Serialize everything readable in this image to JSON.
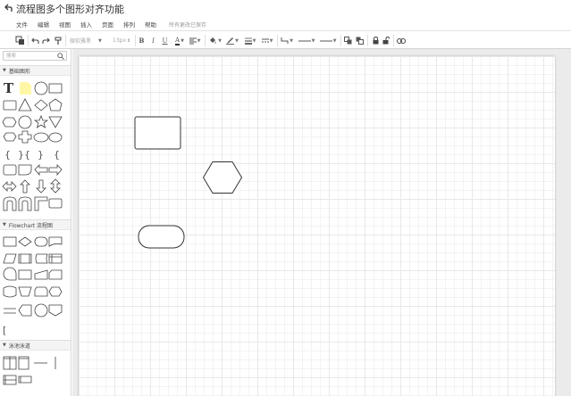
{
  "app": {
    "title": "流程图多个图形对齐功能"
  },
  "menu": {
    "items": [
      "文件",
      "编辑",
      "视图",
      "插入",
      "页面",
      "排列",
      "帮助"
    ],
    "save_status": "所有更改已保存"
  },
  "toolbar": {
    "font_family": "微软雅黑",
    "font_size": "13px",
    "bold_label": "B",
    "italic_label": "I",
    "underline_label": "U",
    "font_color_label": "A"
  },
  "sidebar": {
    "search_placeholder": "搜索",
    "sections": [
      {
        "label": "基础图形",
        "expanded": true
      },
      {
        "label": "Flowchart 流程图",
        "expanded": true
      },
      {
        "label": "泳池泳道",
        "expanded": true
      }
    ],
    "basic_text_glyph": "T",
    "bracket_glyphs": [
      "{",
      "}{",
      "}",
      "{"
    ],
    "flowchart_bracket_glyph": "["
  },
  "canvas": {
    "shapes": [
      {
        "kind": "rectangle",
        "name": "rectangle"
      },
      {
        "kind": "hexagon",
        "name": "hexagon"
      },
      {
        "kind": "rounded-rectangle",
        "name": "terminator"
      }
    ]
  },
  "colors": {
    "grid_major": "#e8e8e8",
    "grid_minor": "#f3f3f3",
    "canvas_bg": "#ebebeb",
    "sticky_note": "#fff7a6"
  }
}
